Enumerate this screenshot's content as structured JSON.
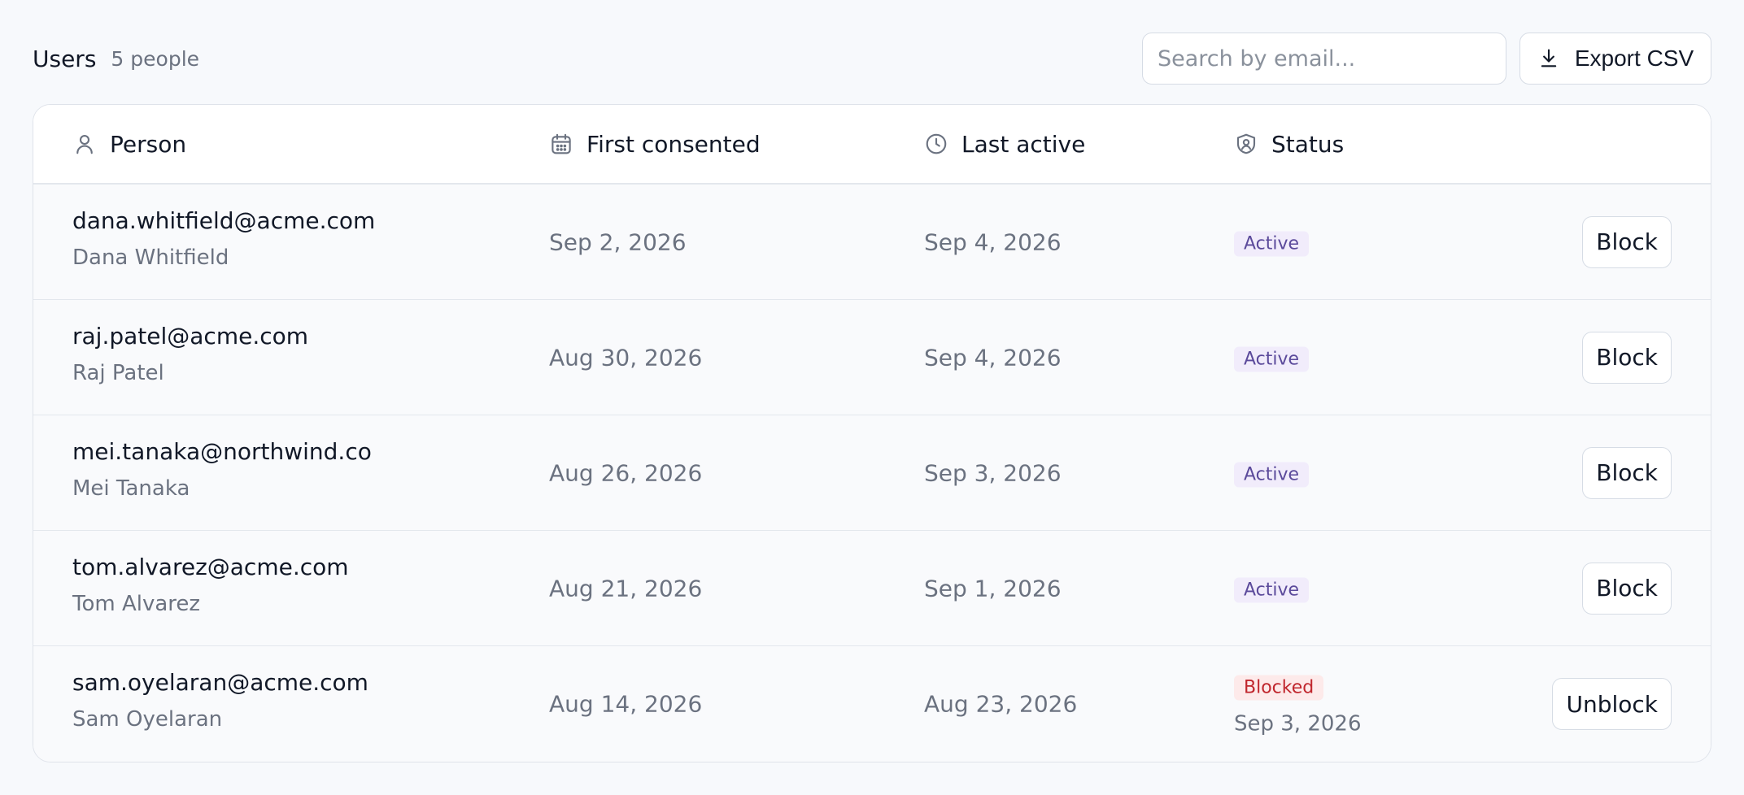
{
  "header": {
    "title": "Users",
    "count": "5 people",
    "search_placeholder": "Search by email...",
    "export_label": "Export CSV"
  },
  "columns": {
    "person": "Person",
    "first_consented": "First consented",
    "last_active": "Last active",
    "status": "Status"
  },
  "rows": [
    {
      "email": "dana.whitfield@acme.com",
      "name": "Dana Whitfield",
      "first_consented": "Sep 2, 2026",
      "last_active": "Sep 4, 2026",
      "status": "Active",
      "status_date": "",
      "action": "Block"
    },
    {
      "email": "raj.patel@acme.com",
      "name": "Raj Patel",
      "first_consented": "Aug 30, 2026",
      "last_active": "Sep 4, 2026",
      "status": "Active",
      "status_date": "",
      "action": "Block"
    },
    {
      "email": "mei.tanaka@northwind.co",
      "name": "Mei Tanaka",
      "first_consented": "Aug 26, 2026",
      "last_active": "Sep 3, 2026",
      "status": "Active",
      "status_date": "",
      "action": "Block"
    },
    {
      "email": "tom.alvarez@acme.com",
      "name": "Tom Alvarez",
      "first_consented": "Aug 21, 2026",
      "last_active": "Sep 1, 2026",
      "status": "Active",
      "status_date": "",
      "action": "Block"
    },
    {
      "email": "sam.oyelaran@acme.com",
      "name": "Sam Oyelaran",
      "first_consented": "Aug 14, 2026",
      "last_active": "Aug 23, 2026",
      "status": "Blocked",
      "status_date": "Sep 3, 2026",
      "action": "Unblock"
    }
  ],
  "colors": {
    "active_badge_bg": "#f1ecfb",
    "active_badge_text": "#5b4a9b",
    "blocked_badge_bg": "#fdeaea",
    "blocked_badge_text": "#c0262d"
  },
  "icons": {
    "person": "user-icon",
    "first_consented": "calendar-icon",
    "last_active": "clock-icon",
    "status": "shield-user-icon",
    "export": "download-icon"
  }
}
